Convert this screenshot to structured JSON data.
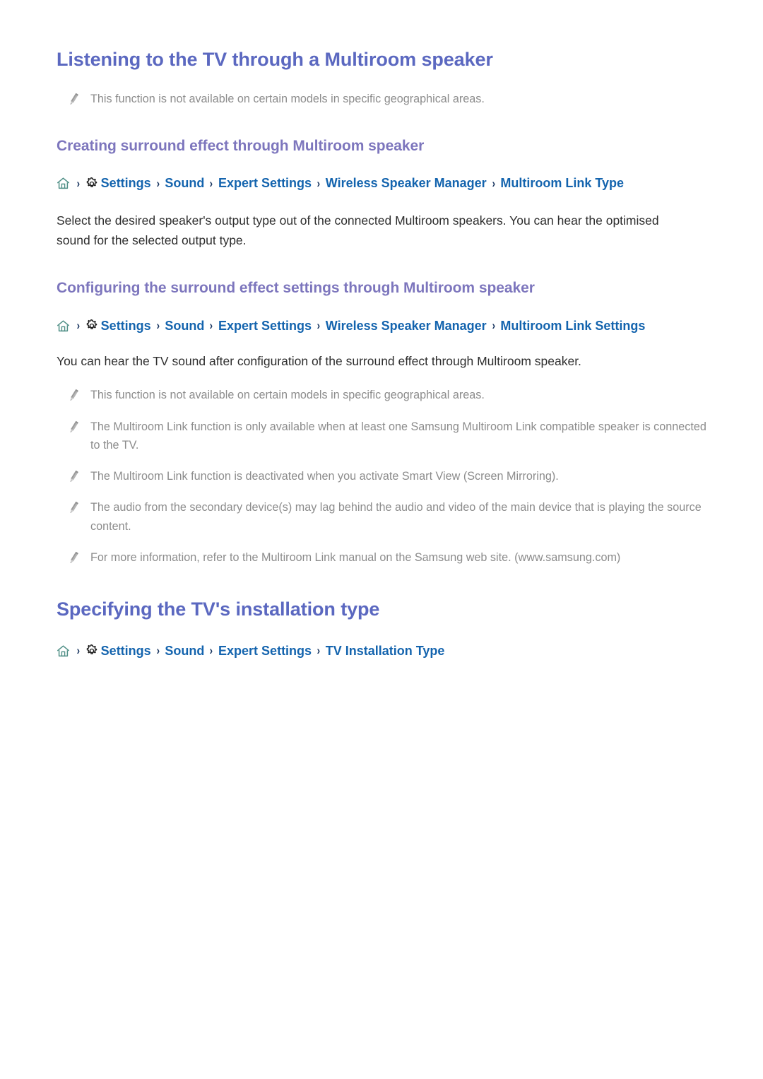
{
  "document": {
    "sections": [
      {
        "id": "multiroom-speaker",
        "title": "Listening to the TV through a Multiroom speaker",
        "notes_after_title": [
          "This function is not available on certain models in specific geographical areas."
        ],
        "subsections": [
          {
            "id": "creating-surround-effect",
            "title": "Creating surround effect through Multiroom speaker",
            "breadcrumb": {
              "home_icon": "home-icon",
              "gear_icon": "gear-icon",
              "separator": "›",
              "items": [
                "Settings",
                "Sound",
                "Expert Settings",
                "Wireless Speaker Manager",
                "Multiroom Link Type"
              ]
            },
            "paragraph": "Select the desired speaker's output type out of the connected Multiroom speakers. You can hear the optimised sound for the selected output type.",
            "notes": []
          },
          {
            "id": "configuring-surround-effect-settings",
            "title": "Configuring the surround effect settings through Multiroom speaker",
            "breadcrumb": {
              "home_icon": "home-icon",
              "gear_icon": "gear-icon",
              "separator": "›",
              "items": [
                "Settings",
                "Sound",
                "Expert Settings",
                "Wireless Speaker Manager",
                "Multiroom Link Settings"
              ]
            },
            "paragraph": "You can hear the TV sound after configuration of the surround effect through Multiroom speaker.",
            "notes": [
              "This function is not available on certain models in specific geographical areas.",
              "The Multiroom Link function is only available when at least one Samsung Multiroom Link compatible speaker is connected to the TV.",
              "The Multiroom Link function is deactivated when you activate Smart View (Screen Mirroring).",
              "The audio from the secondary device(s) may lag behind the audio and video of the main device that is playing the source content.",
              "For more information, refer to the Multiroom Link manual on the Samsung web site. (www.samsung.com)"
            ]
          }
        ]
      },
      {
        "id": "tv-installation-type",
        "title": "Specifying the TV's installation type",
        "notes_after_title": [],
        "subsections": [
          {
            "id": "tv-installation-type-path",
            "title": "",
            "breadcrumb": {
              "home_icon": "home-icon",
              "gear_icon": "gear-icon",
              "separator": "›",
              "items": [
                "Settings",
                "Sound",
                "Expert Settings",
                "TV Installation Type"
              ]
            },
            "paragraph": "",
            "notes": []
          }
        ]
      }
    ]
  },
  "icons": {
    "note_bullet": "pencil-icon",
    "home": "home-icon",
    "gear": "gear-icon",
    "chevron": "chevron-right-icon"
  },
  "colors": {
    "doc_title": "#5b68c0",
    "section_title": "#7d76bd",
    "breadcrumb_link": "#1464ae",
    "breadcrumb_separator": "#16335e",
    "body_text": "#2e2e2e",
    "note_text": "#8c8c8c",
    "home_icon": "#4f8f86",
    "gear_icon": "#1d1d1d",
    "pencil_icon": "#a8a8a8",
    "background": "#ffffff"
  }
}
